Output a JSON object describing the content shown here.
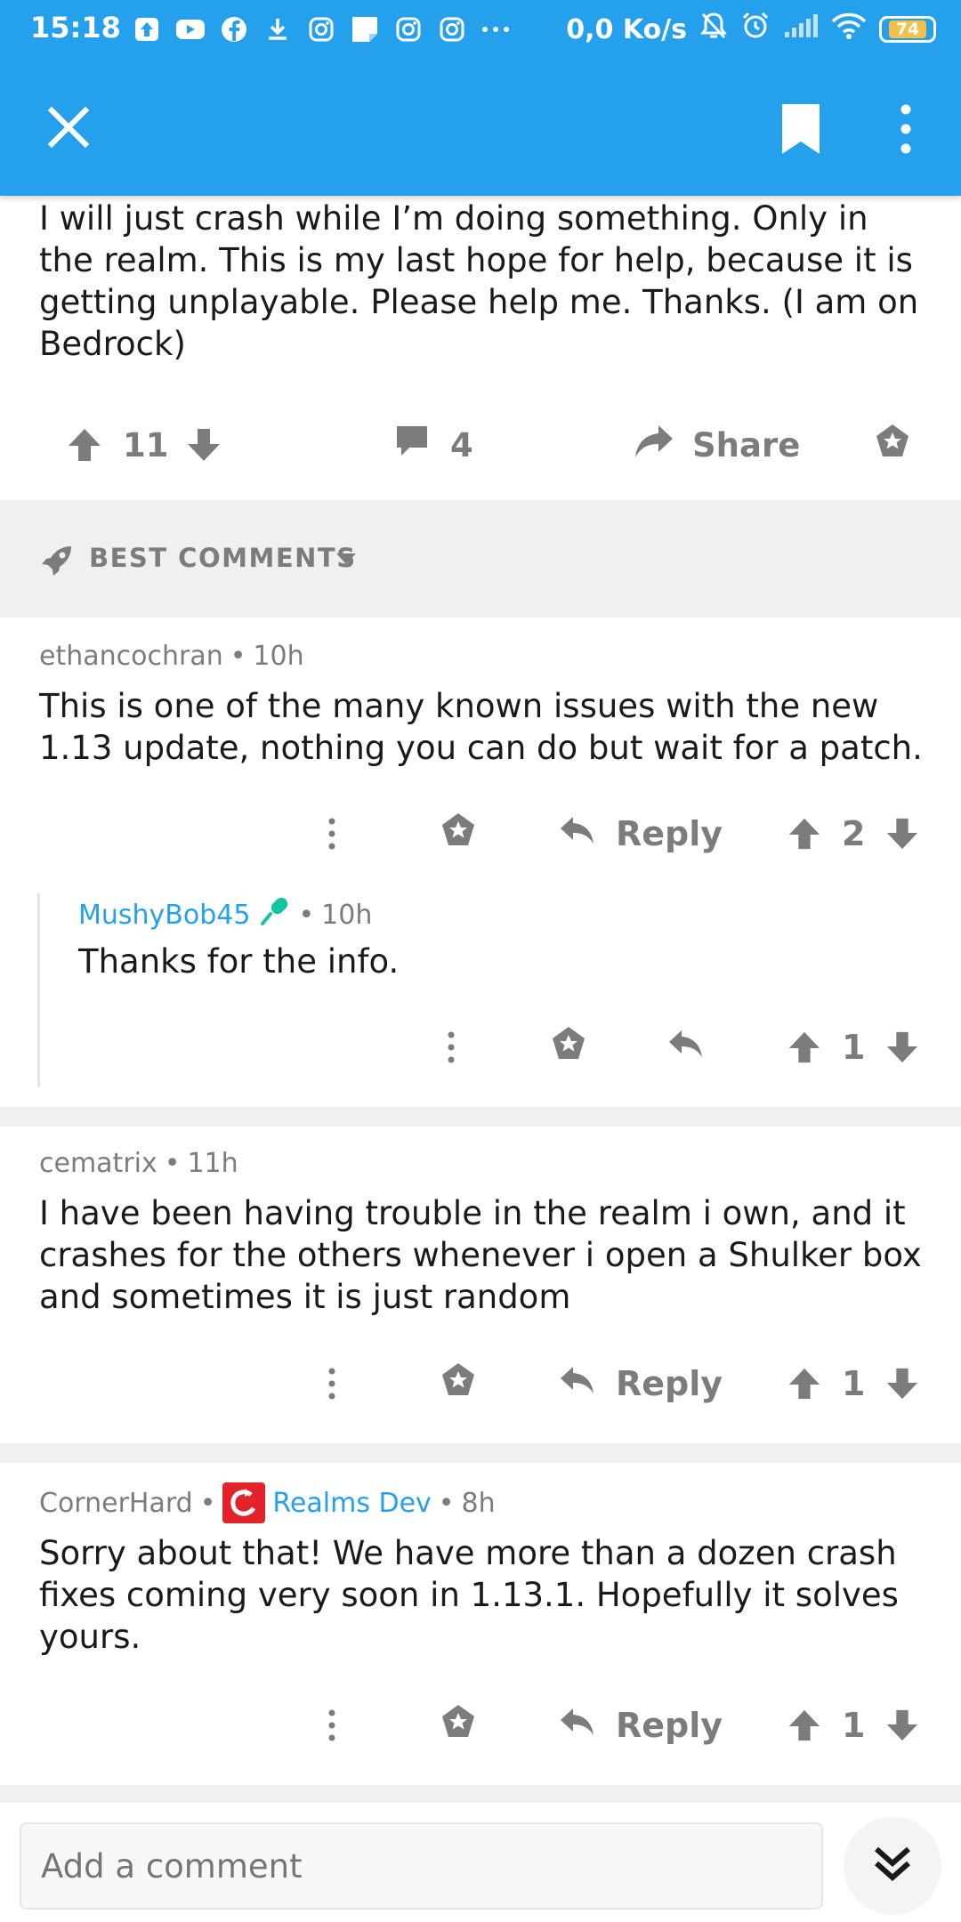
{
  "status_bar": {
    "time": "15:18",
    "net_speed": "0,0 Ko/s",
    "battery": "74",
    "left_icons": [
      "upload-icon",
      "youtube-icon",
      "facebook-icon",
      "download-icon",
      "instagram-icon",
      "notes-icon",
      "instagram-icon",
      "instagram-icon",
      "more-dots-icon"
    ],
    "right_icons": [
      "mute-icon",
      "alarm-icon",
      "signal-icon",
      "wifi-icon",
      "battery-icon"
    ]
  },
  "toolbar": {
    "close_icon": "close-icon",
    "bookmark_icon": "bookmark-icon",
    "more_icon": "more-vertical-icon"
  },
  "post": {
    "body": "I will just crash while I’m doing something. Only in the realm. This is my last hope for help, because it is getting unplayable. Please help me. Thanks. (I am on Bedrock)",
    "score": "11",
    "comment_count": "4",
    "share_label": "Share"
  },
  "sort": {
    "label": "BEST COMMENTS"
  },
  "comments": [
    {
      "author": "ethancochran",
      "sep": "•",
      "time": "10h",
      "body": "This is one of the many known issues with the new 1.13 update, nothing you can do but wait for a patch.",
      "reply_label": "Reply",
      "score": "2"
    },
    {
      "author": "MushyBob45",
      "sep": "•",
      "time": "10h",
      "body": "Thanks for the info.",
      "score": "1"
    },
    {
      "author": "cematrix",
      "sep": "•",
      "time": "11h",
      "body": "I have been having trouble in the realm i own, and it crashes for the others whenever i open a Shulker box and sometimes it is just random",
      "reply_label": "Reply",
      "score": "1"
    },
    {
      "author": "CornerHard",
      "sep": "•",
      "flair": "Realms Dev",
      "time": "8h",
      "body": "Sorry about that! We have more than a dozen crash fixes coming very soon in 1.13.1. Hopefully it solves yours.",
      "reply_label": "Reply",
      "score": "1"
    }
  ],
  "bottom": {
    "placeholder": "Add a comment"
  },
  "colors": {
    "accent": "#24a0ed",
    "text": "#1a1a1b",
    "muted": "#7c7c7c",
    "separator": "#eff0f1",
    "flair_badge": "#e2232a"
  }
}
